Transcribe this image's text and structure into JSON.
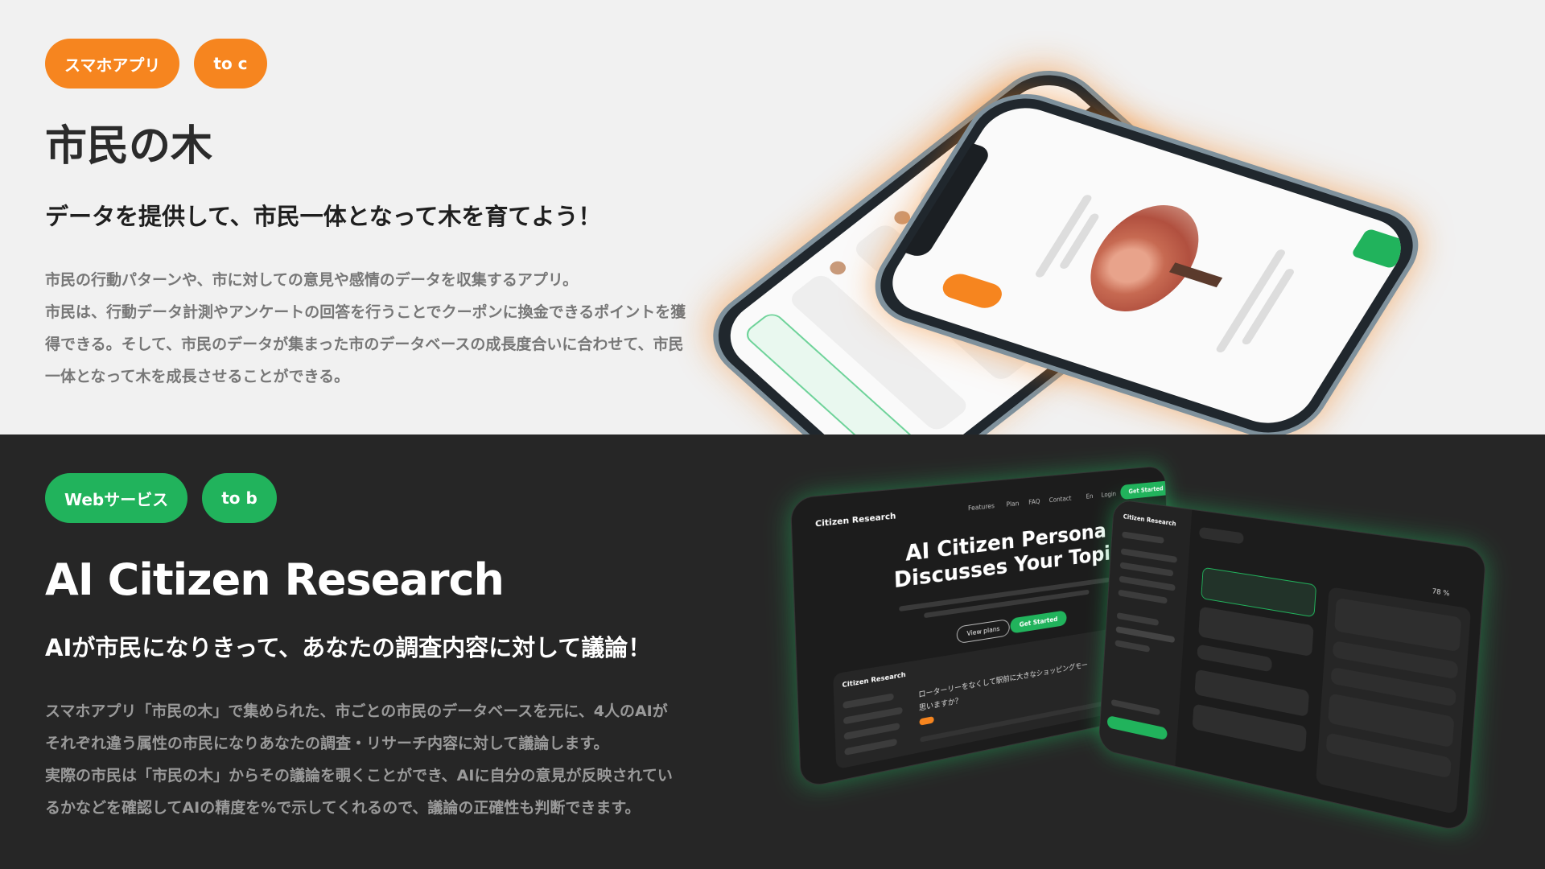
{
  "section1": {
    "tags": [
      "スマホアプリ",
      "to c"
    ],
    "title": "市民の木",
    "subtitle": "データを提供して、市民一体となって木を育てよう！",
    "description": [
      "市民の行動パターンや、市に対しての意見や感情のデータを収集するアプリ。",
      "市民は、行動データ計測やアンケートの回答を行うことでクーポンに換金できるポイントを獲",
      "得できる。そして、市民のデータが集まった市のデータベースの成長度合いに合わせて、市民",
      "一体となって木を成長させることができる。"
    ]
  },
  "section2": {
    "tags": [
      "Webサービス",
      "to b"
    ],
    "title": "AI Citizen Research",
    "subtitle": "AIが市民になりきって、あなたの調査内容に対して議論！",
    "description": [
      "スマホアプリ「市民の木」で集められた、市ごとの市民のデータベースを元に、4人のAIが",
      "それぞれ違う属性の市民になりあなたの調査・リサーチ内容に対して議論します。",
      "実際の市民は「市民の木」からその議論を覗くことができ、AIに自分の意見が反映されてい",
      "るかなどを確認してAIの精度を%で示してくれるので、議論の正確性も判断できます。"
    ],
    "mockup": {
      "logo": "Citizen Research",
      "nav": [
        "Features",
        "Plan",
        "FAQ",
        "Contact"
      ],
      "lang": "En",
      "login": "Login",
      "get_started": "Get Started",
      "hero_line1": "AI Citizen Persona",
      "hero_line2": "Discusses Your Topic",
      "view_plans": "View plans",
      "question": "ローターリーをなくして駅前に大きなショッピングモー",
      "question2": "思いますか？",
      "percent": "78 %"
    }
  },
  "colors": {
    "orange": "#f6851f",
    "green": "#21b35c",
    "light_bg": "#f1f1f1",
    "dark_bg": "#262626"
  }
}
